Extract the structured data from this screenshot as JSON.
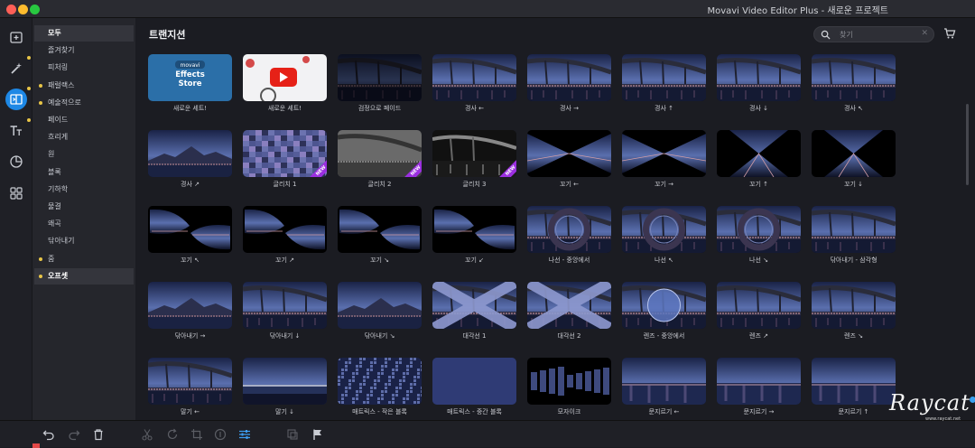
{
  "window": {
    "title": "Movavi Video Editor Plus - 새로운 프로젝트"
  },
  "toolbar": {
    "tools": [
      {
        "name": "import-tool",
        "icon": "import-icon",
        "active": false,
        "dot": false
      },
      {
        "name": "filters-tool",
        "icon": "magic-wand-icon",
        "active": false,
        "dot": true
      },
      {
        "name": "transitions-tool",
        "icon": "transitions-icon",
        "active": true,
        "dot": true
      },
      {
        "name": "titles-tool",
        "icon": "titles-icon",
        "active": false,
        "dot": true
      },
      {
        "name": "stickers-tool",
        "icon": "stickers-icon",
        "active": false,
        "dot": false
      },
      {
        "name": "more-tools",
        "icon": "grid-icon",
        "active": false,
        "dot": false
      }
    ]
  },
  "sidebar": {
    "categories": [
      {
        "label": "모두",
        "selected": true,
        "dot": false
      },
      {
        "label": "즐겨찾기",
        "selected": false,
        "dot": false
      },
      {
        "label": "피처링",
        "selected": false,
        "dot": false
      },
      {
        "label": "패럴랙스",
        "selected": false,
        "dot": true
      },
      {
        "label": "예술적으로",
        "selected": false,
        "dot": true
      },
      {
        "label": "페이드",
        "selected": false,
        "dot": false
      },
      {
        "label": "흐리게",
        "selected": false,
        "dot": false
      },
      {
        "label": "원",
        "selected": false,
        "dot": false
      },
      {
        "label": "블록",
        "selected": false,
        "dot": false
      },
      {
        "label": "기하학",
        "selected": false,
        "dot": false
      },
      {
        "label": "물결",
        "selected": false,
        "dot": false
      },
      {
        "label": "왜곡",
        "selected": false,
        "dot": false
      },
      {
        "label": "닦아내기",
        "selected": false,
        "dot": false
      },
      {
        "label": "줌",
        "selected": false,
        "dot": true
      },
      {
        "label": "오프셋",
        "selected": true,
        "dot": true
      }
    ]
  },
  "main": {
    "title": "트랜지션",
    "search": {
      "placeholder": "찾기",
      "value": ""
    },
    "tiles": [
      {
        "label": "새로운 세트!",
        "style": "effects",
        "new": false,
        "store_brand": "movavi",
        "store_title": "Effects Store"
      },
      {
        "label": "새로운 세트!",
        "style": "youtube",
        "new": false
      },
      {
        "label": "검정으로 페이드",
        "style": "fadeblack",
        "new": false
      },
      {
        "label": "경사 ←",
        "style": "city",
        "new": false
      },
      {
        "label": "경사 →",
        "style": "city",
        "new": false
      },
      {
        "label": "경사 ↑",
        "style": "city",
        "new": false
      },
      {
        "label": "경사 ↓",
        "style": "city",
        "new": false
      },
      {
        "label": "경사 ↖",
        "style": "city",
        "new": false
      },
      {
        "label": "경사 ↗",
        "style": "mountain",
        "new": false
      },
      {
        "label": "글리치 1",
        "style": "glitch",
        "new": true
      },
      {
        "label": "글리치 2",
        "style": "gray",
        "new": true
      },
      {
        "label": "글리치 3",
        "style": "bw",
        "new": true
      },
      {
        "label": "꼬기 ←",
        "style": "bowtie-h",
        "new": false
      },
      {
        "label": "꼬기 →",
        "style": "bowtie-h",
        "new": false
      },
      {
        "label": "꼬기 ↑",
        "style": "bowtie-v",
        "new": false
      },
      {
        "label": "꼬기 ↓",
        "style": "bowtie-v",
        "new": false
      },
      {
        "label": "꼬기 ↖",
        "style": "twist",
        "new": false
      },
      {
        "label": "꼬기 ↗",
        "style": "twist",
        "new": false
      },
      {
        "label": "꼬기 ↘",
        "style": "twist",
        "new": false
      },
      {
        "label": "꼬기 ↙",
        "style": "twist",
        "new": false
      },
      {
        "label": "나선 - 중앙에서",
        "style": "spiral",
        "new": false
      },
      {
        "label": "나선 ↖",
        "style": "spiral",
        "new": false
      },
      {
        "label": "나선 ↘",
        "style": "spiral",
        "new": false
      },
      {
        "label": "닦아내기 - 삼각형",
        "style": "city",
        "new": false
      },
      {
        "label": "닦아내기 →",
        "style": "mountain",
        "new": false
      },
      {
        "label": "닦아내기 ↓",
        "style": "city",
        "new": false
      },
      {
        "label": "닦아내기 ↘",
        "style": "mountain",
        "new": false
      },
      {
        "label": "대각선 1",
        "style": "diagonal",
        "new": false
      },
      {
        "label": "대각선 2",
        "style": "diagonal",
        "new": false
      },
      {
        "label": "렌즈 - 중앙에서",
        "style": "lens",
        "new": false
      },
      {
        "label": "렌즈 ↗",
        "style": "city",
        "new": false
      },
      {
        "label": "렌즈 ↘",
        "style": "city",
        "new": false
      },
      {
        "label": "말기 ←",
        "style": "city",
        "new": false
      },
      {
        "label": "말기 ↓",
        "style": "sea",
        "new": false
      },
      {
        "label": "매트릭스 - 작은 블록",
        "style": "matrix-small",
        "new": false
      },
      {
        "label": "매트릭스 - 중간 블록",
        "style": "matrix-mid",
        "new": false
      },
      {
        "label": "모자이크",
        "style": "mosaic",
        "new": false
      },
      {
        "label": "문지르기 ←",
        "style": "smear",
        "new": false
      },
      {
        "label": "문지르기 →",
        "style": "smear",
        "new": false
      },
      {
        "label": "문지르기 ↑",
        "style": "smear",
        "new": false
      }
    ]
  },
  "bottom": {
    "buttons": [
      {
        "name": "undo-button",
        "icon": "undo-icon",
        "state": "normal"
      },
      {
        "name": "redo-button",
        "icon": "redo-icon",
        "state": "dim"
      },
      {
        "name": "delete-button",
        "icon": "trash-icon",
        "state": "normal"
      },
      {
        "name": "cut-button",
        "icon": "scissors-icon",
        "state": "dim"
      },
      {
        "name": "rotate-button",
        "icon": "rotate-icon",
        "state": "dim"
      },
      {
        "name": "crop-button",
        "icon": "crop-icon",
        "state": "dim"
      },
      {
        "name": "color-button",
        "icon": "color-adjust-icon",
        "state": "dim"
      },
      {
        "name": "clip-properties-button",
        "icon": "sliders-icon",
        "state": "blue"
      },
      {
        "name": "insert-button",
        "icon": "insert-icon",
        "state": "dim"
      },
      {
        "name": "marker-button",
        "icon": "flag-icon",
        "state": "normal"
      }
    ]
  },
  "watermark": {
    "text": "Raycat",
    "sub": "www.raycat.net"
  },
  "colors": {
    "accent": "#1e88e5",
    "dot": "#e8c547",
    "new_badge": "#9b2fe0"
  },
  "new_badge_text": "NEW"
}
